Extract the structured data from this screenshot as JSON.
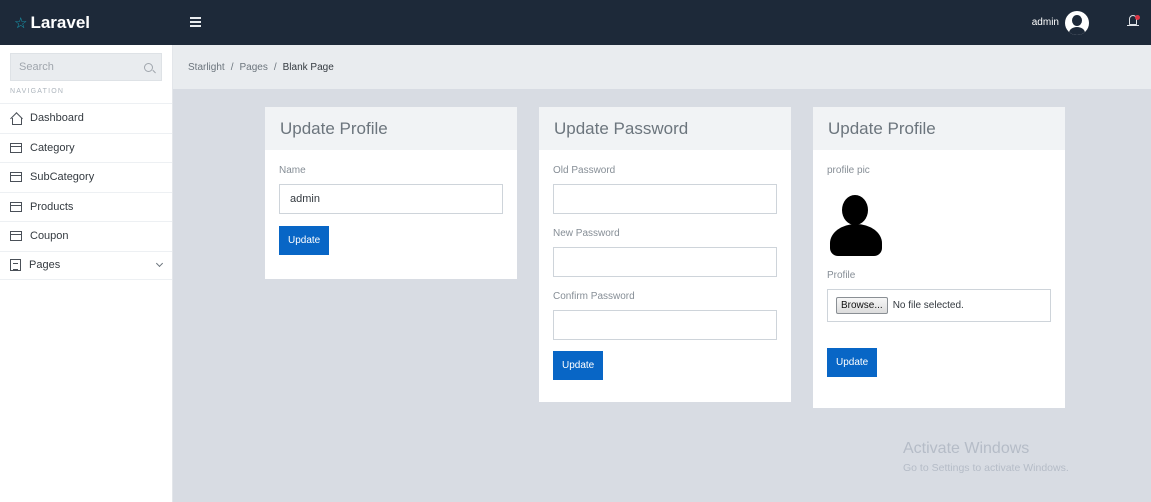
{
  "app": {
    "logo_star": "☆",
    "logo_text": "Laravel"
  },
  "header": {
    "user_name": "admin"
  },
  "sidebar": {
    "search_placeholder": "Search",
    "nav_label": "NAVIGATION",
    "items": [
      {
        "label": "Dashboard",
        "icon": "home-icon"
      },
      {
        "label": "Category",
        "icon": "box-icon"
      },
      {
        "label": "SubCategory",
        "icon": "box-icon"
      },
      {
        "label": "Products",
        "icon": "box-icon"
      },
      {
        "label": "Coupon",
        "icon": "box-icon"
      },
      {
        "label": "Pages",
        "icon": "document-icon"
      }
    ]
  },
  "breadcrumb": {
    "items": [
      "Starlight",
      "Pages",
      "Blank Page"
    ],
    "separator": "/"
  },
  "cards": {
    "profile": {
      "title": "Update Profile",
      "name_label": "Name",
      "name_value": "admin",
      "button": "Update"
    },
    "password": {
      "title": "Update Password",
      "old_label": "Old Password",
      "new_label": "New Password",
      "confirm_label": "Confirm Password",
      "button": "Update"
    },
    "picture": {
      "title": "Update Profile",
      "pic_label": "profile pic",
      "file_label": "Profile",
      "browse_label": "Browse...",
      "file_status": "No file selected.",
      "button": "Update"
    }
  },
  "watermark": {
    "title": "Activate Windows",
    "subtitle": "Go to Settings to activate Windows."
  },
  "colors": {
    "header_bg": "#1d2939",
    "primary_button": "#0866c6",
    "notification_dot": "#dc3545"
  }
}
